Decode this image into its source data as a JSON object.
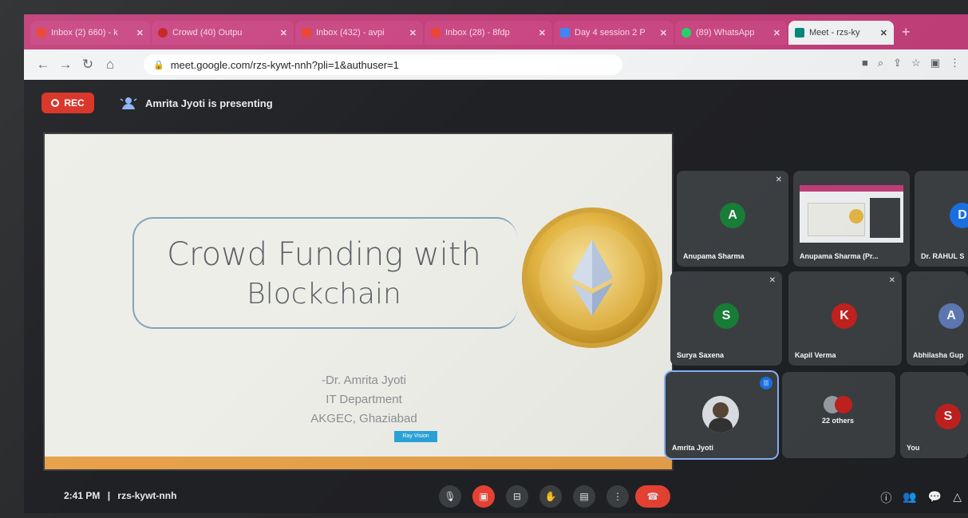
{
  "browser": {
    "tabs": [
      {
        "label": "Inbox (2) 660) - k",
        "color": "#ea4335"
      },
      {
        "label": "Crowd (40) Outpu",
        "color": "#c5221f"
      },
      {
        "label": "Inbox (432) - avpi",
        "color": "#ea4335"
      },
      {
        "label": "Inbox (28) - 8fdp",
        "color": "#ea4335"
      },
      {
        "label": "Day 4 session 2 P",
        "color": "#4285f4"
      },
      {
        "label": "(89) WhatsApp",
        "color": "#25d366"
      },
      {
        "label": "Meet - rzs-ky",
        "color": "#00897b"
      }
    ],
    "url": "meet.google.com/rzs-kywt-nnh?pli=1&authuser=1"
  },
  "meet": {
    "rec_label": "REC",
    "presenting_text": "Amrita Jyoti is presenting",
    "time": "2:41 PM",
    "separator": "|",
    "meeting_code": "rzs-kywt-nnh"
  },
  "slide": {
    "title_line1": "Crowd Funding with",
    "title_line2": "Blockchain",
    "author": "-Dr. Amrita Jyoti",
    "department": "IT Department",
    "institution": "AKGEC, Ghaziabad",
    "small_badge": "Ray Vision"
  },
  "participants": [
    {
      "name": "Anupama Sharma",
      "initial": "A",
      "avatar_color": "#188038"
    },
    {
      "name": "Anupama Sharma (Pr...",
      "initial": "",
      "avatar_color": ""
    },
    {
      "name": "Dr. RAHUL S",
      "initial": "D",
      "avatar_color": "#1a73e8"
    },
    {
      "name": "Surya Saxena",
      "initial": "S",
      "avatar_color": "#188038"
    },
    {
      "name": "Kapil Verma",
      "initial": "K",
      "avatar_color": "#c5221f"
    },
    {
      "name": "Abhilasha Gup",
      "initial": "A",
      "avatar_color": "#5f7bb8"
    },
    {
      "name": "Amrita Jyoti",
      "initial": "",
      "avatar_color": ""
    },
    {
      "name": "22 others",
      "initial": "",
      "avatar_color": ""
    },
    {
      "name": "You",
      "initial": "S",
      "avatar_color": "#c5221f"
    }
  ],
  "colors": {
    "tab_strip": "#c2407a",
    "rec_red": "#d93025",
    "end_call_red": "#ea4335",
    "slide_accent": "#e8a14a"
  }
}
